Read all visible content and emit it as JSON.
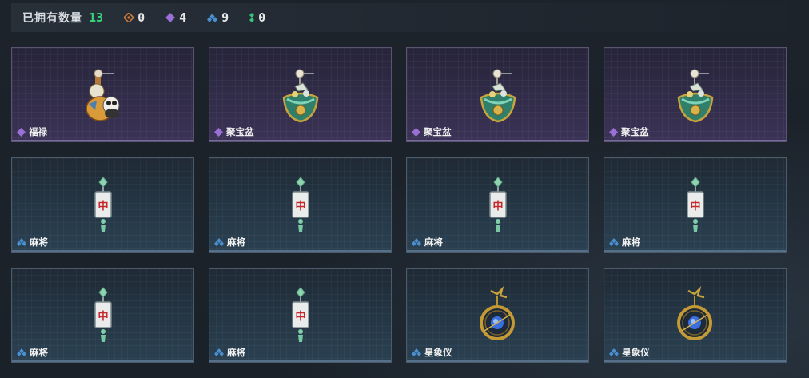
{
  "header": {
    "owned_label": "已拥有数量",
    "owned_total": "13",
    "counts": [
      {
        "icon": "orange-rarity-icon",
        "color": "#d07a3a",
        "value": "0"
      },
      {
        "icon": "purple-rarity-icon",
        "color": "#9a6fd6",
        "value": "4"
      },
      {
        "icon": "blue-rarity-icon",
        "color": "#4a8fd0",
        "value": "9"
      },
      {
        "icon": "green-rarity-icon",
        "color": "#38c27a",
        "value": "0"
      }
    ]
  },
  "items": [
    {
      "name": "福禄",
      "rarity": "purple",
      "art": "gourd-charm"
    },
    {
      "name": "聚宝盆",
      "rarity": "purple",
      "art": "treasure-bowl-charm"
    },
    {
      "name": "聚宝盆",
      "rarity": "purple",
      "art": "treasure-bowl-charm"
    },
    {
      "name": "聚宝盆",
      "rarity": "purple",
      "art": "treasure-bowl-charm"
    },
    {
      "name": "麻将",
      "rarity": "blue",
      "art": "mahjong-charm"
    },
    {
      "name": "麻将",
      "rarity": "blue",
      "art": "mahjong-charm"
    },
    {
      "name": "麻将",
      "rarity": "blue",
      "art": "mahjong-charm"
    },
    {
      "name": "麻将",
      "rarity": "blue",
      "art": "mahjong-charm"
    },
    {
      "name": "麻将",
      "rarity": "blue",
      "art": "mahjong-charm"
    },
    {
      "name": "麻将",
      "rarity": "blue",
      "art": "mahjong-charm"
    },
    {
      "name": "星象仪",
      "rarity": "blue",
      "art": "astrolabe-charm"
    },
    {
      "name": "星象仪",
      "rarity": "blue",
      "art": "astrolabe-charm"
    }
  ],
  "mahjong_tile_char": "中"
}
